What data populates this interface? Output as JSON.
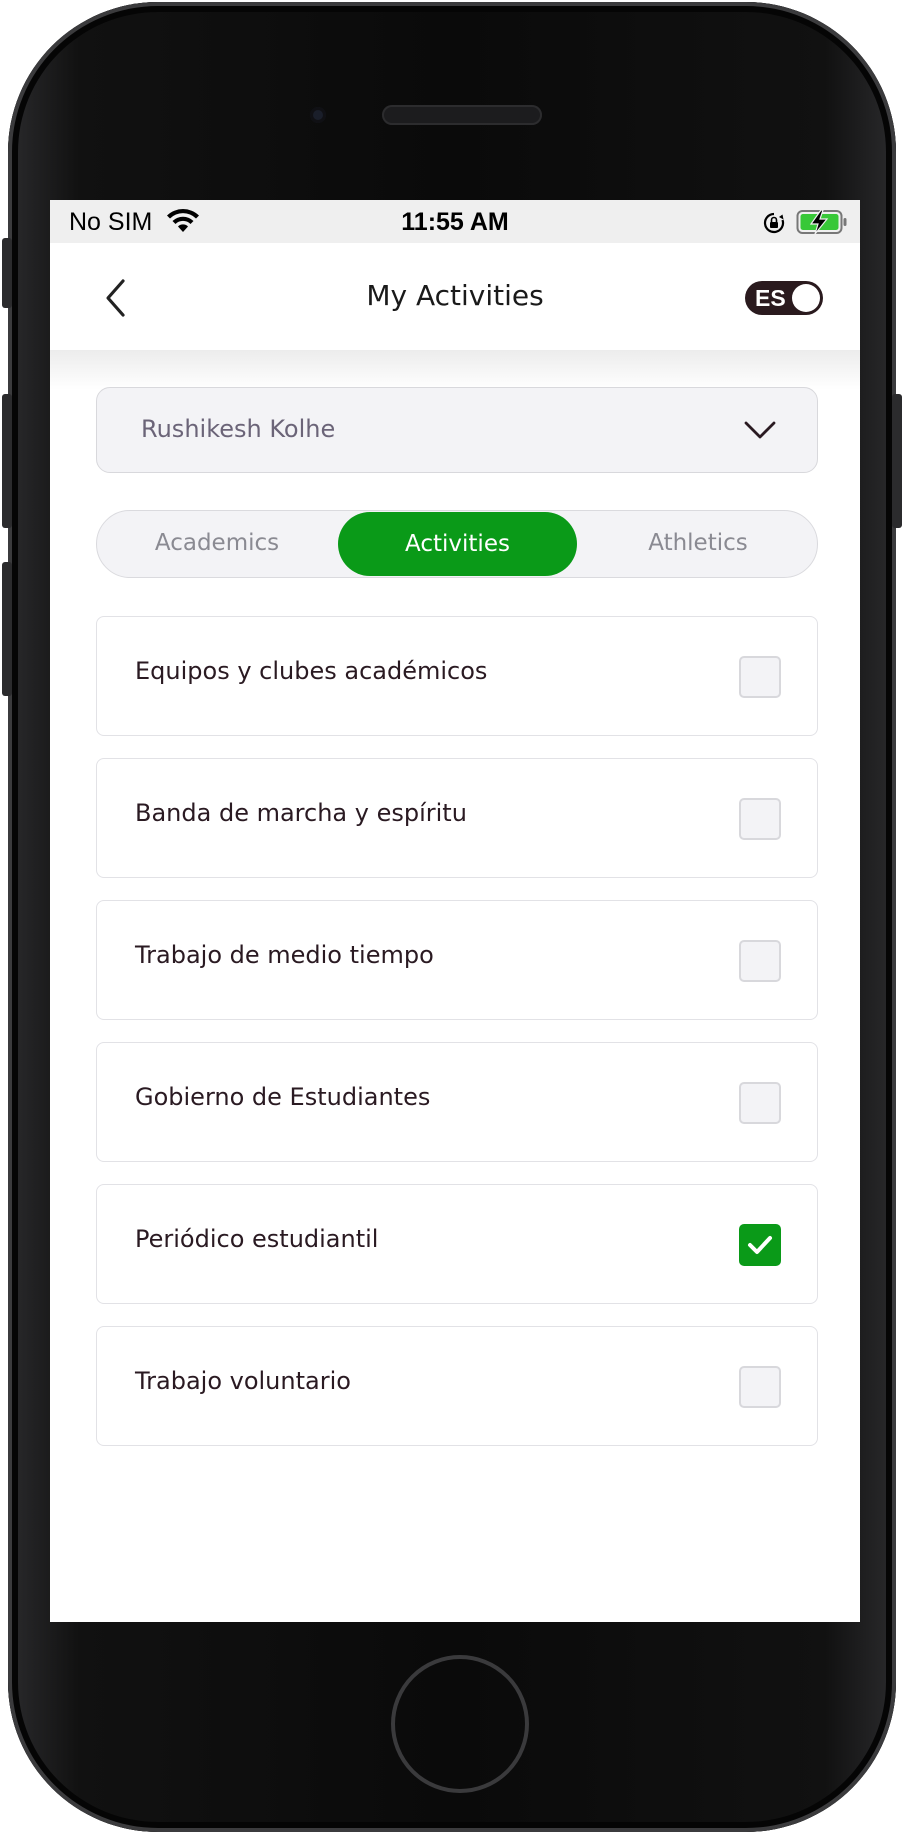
{
  "status_bar": {
    "carrier": "No SIM",
    "time": "11:55 AM",
    "wifi_icon": "wifi-icon",
    "orientation_lock_icon": "lock-rotation-icon",
    "battery_icon": "battery-charging-icon"
  },
  "header": {
    "title": "My Activities",
    "back_icon": "chevron-left-icon",
    "language_toggle": {
      "label": "ES",
      "on": true
    }
  },
  "student_select": {
    "value": "Rushikesh Kolhe",
    "icon": "chevron-down-icon"
  },
  "tabs": [
    {
      "label": "Academics",
      "active": false
    },
    {
      "label": "Activities",
      "active": true
    },
    {
      "label": "Athletics",
      "active": false
    }
  ],
  "activities": [
    {
      "label": "Equipos y clubes académicos",
      "checked": false
    },
    {
      "label": "Banda de marcha y espíritu",
      "checked": false
    },
    {
      "label": "Trabajo de medio tiempo",
      "checked": false
    },
    {
      "label": "Gobierno de Estudiantes",
      "checked": false
    },
    {
      "label": "Periódico estudiantil",
      "checked": true
    },
    {
      "label": "Trabajo voluntario",
      "checked": false
    }
  ],
  "colors": {
    "accent": "#0a9a18",
    "toggle_background": "#2a1a1e",
    "select_text": "#6b6478",
    "inactive_tab_text": "#8a8a92"
  }
}
